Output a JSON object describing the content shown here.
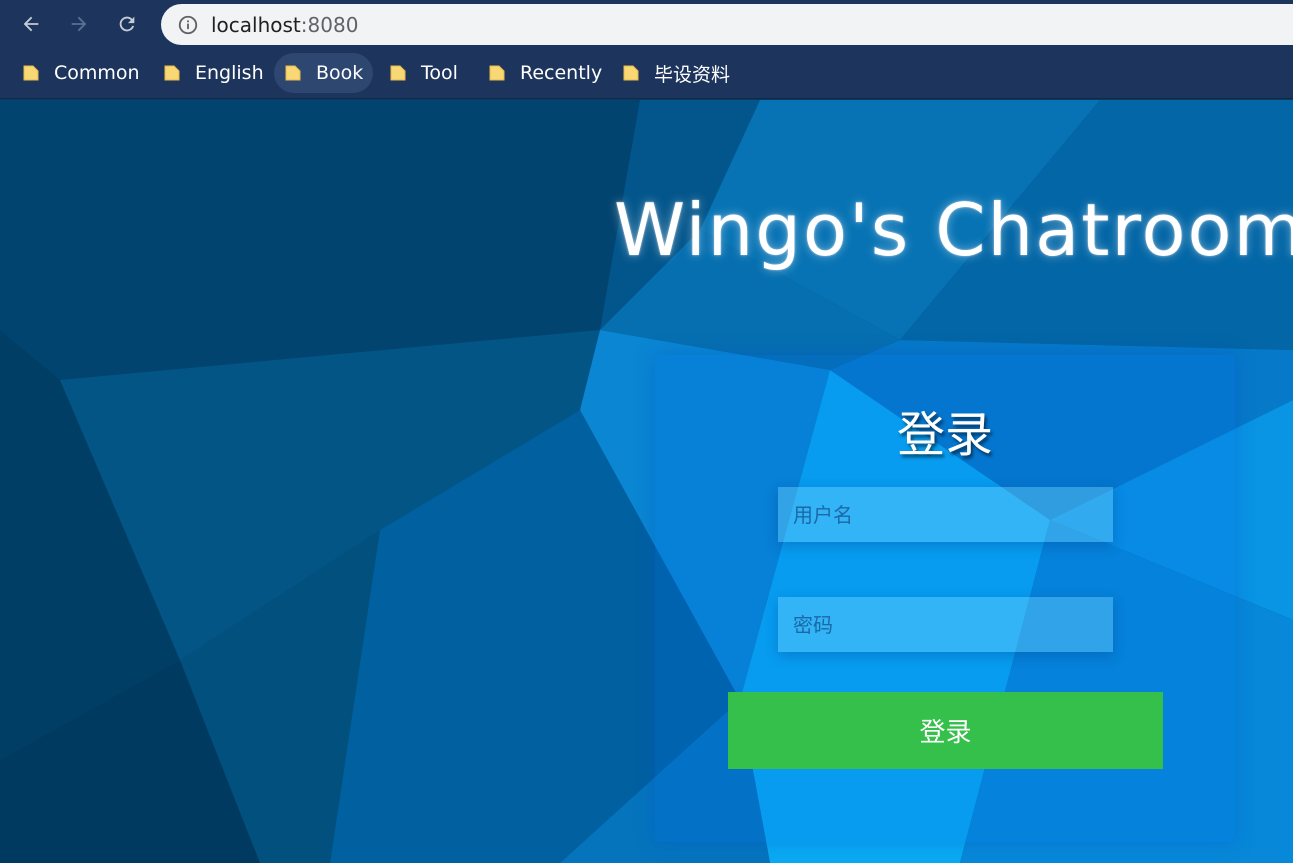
{
  "browser": {
    "url_host": "localhost",
    "url_port": ":8080",
    "bookmarks": [
      {
        "label": "Common"
      },
      {
        "label": "English"
      },
      {
        "label": "Book"
      },
      {
        "label": "Tool"
      },
      {
        "label": "Recently"
      },
      {
        "label": "毕设资料"
      }
    ]
  },
  "page": {
    "title": "Wingo's Chatroom",
    "login": {
      "heading": "登录",
      "username_placeholder": "用户名",
      "password_placeholder": "密码",
      "submit_label": "登录"
    }
  },
  "colors": {
    "chrome_bg": "#1d355c",
    "login_button": "#34c04b",
    "background_base": "#0a3a5c"
  },
  "icons": [
    "back-arrow-icon",
    "forward-arrow-icon",
    "reload-icon",
    "info-icon",
    "folder-icon"
  ]
}
